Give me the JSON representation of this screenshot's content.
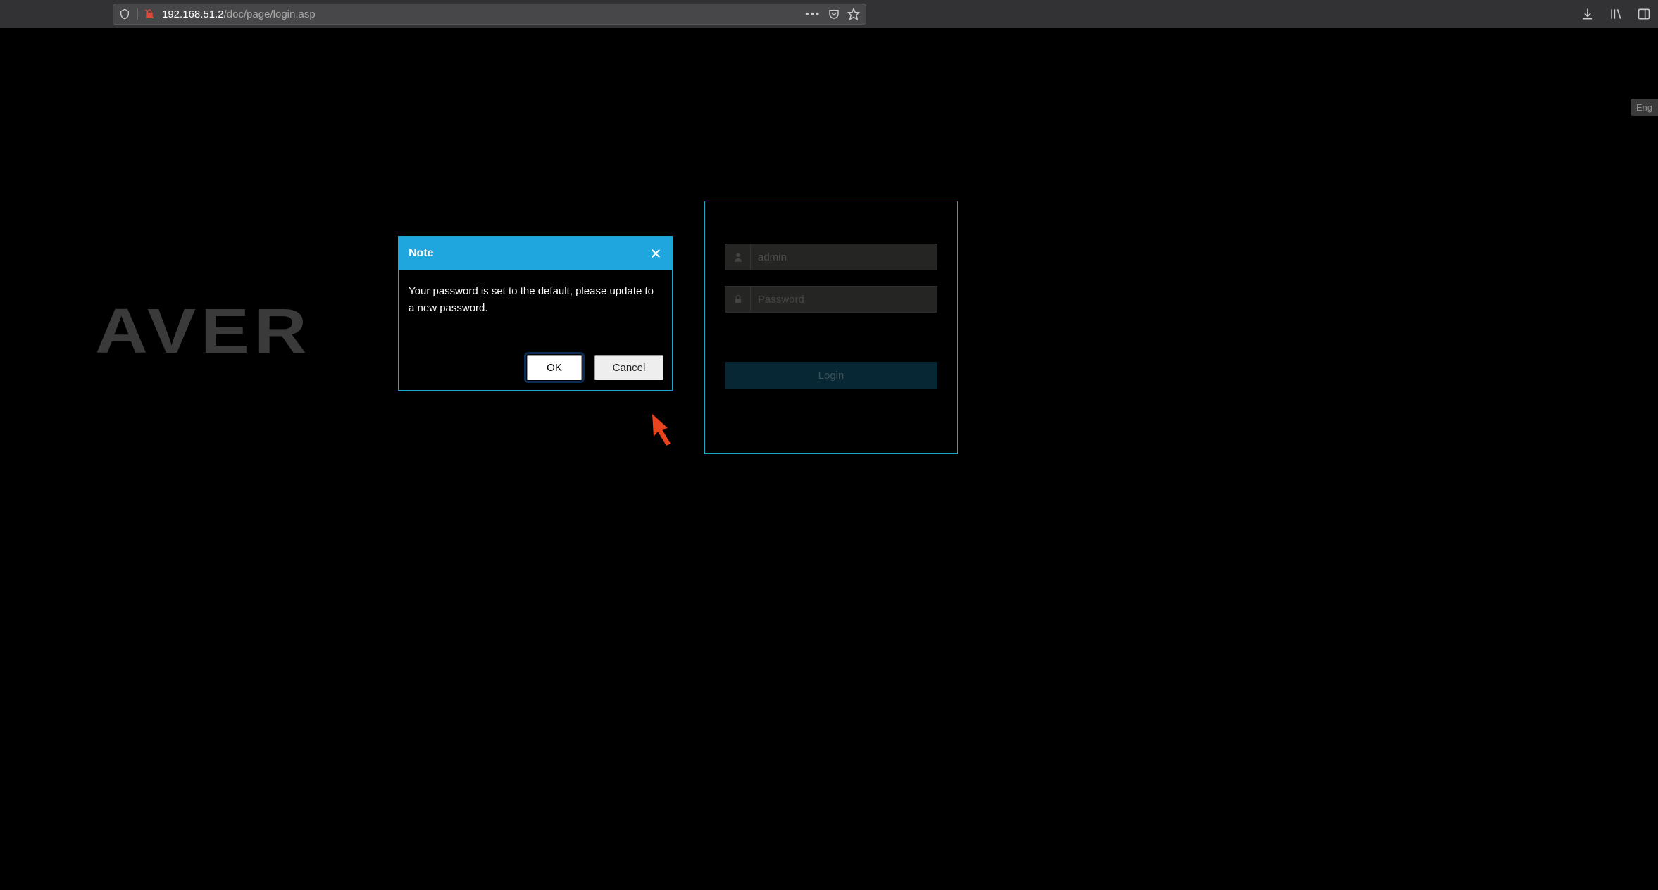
{
  "browser": {
    "url_host": "192.168.51.2",
    "url_path": "/doc/page/login.asp"
  },
  "lang_label": "Eng",
  "logo_text": "AVER",
  "login": {
    "username_value": "admin",
    "password_placeholder": "Password",
    "button_label": "Login"
  },
  "modal": {
    "title": "Note",
    "message": "Your password is set to the default, please update to a new password.",
    "ok_label": "OK",
    "cancel_label": "Cancel"
  }
}
